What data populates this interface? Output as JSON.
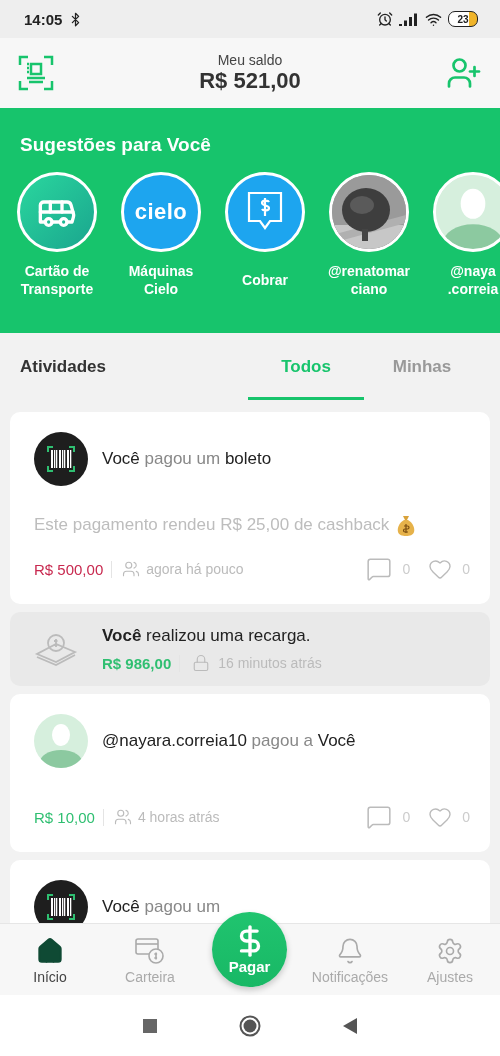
{
  "status_bar": {
    "time": "14:05",
    "battery": "23"
  },
  "header": {
    "balance_label": "Meu saldo",
    "balance": "R$ 521,00"
  },
  "suggestions": {
    "title": "Sugestões para Você",
    "items": [
      {
        "kind": "bus",
        "label_lines": [
          "Cartão de",
          "Transporte"
        ]
      },
      {
        "kind": "cielo",
        "logo_text": "cielo",
        "label_lines": [
          "Máquinas",
          "Cielo"
        ]
      },
      {
        "kind": "charge",
        "label_lines": [
          "Cobrar"
        ]
      },
      {
        "label_lines": [
          "@renatomar",
          "ciano"
        ]
      },
      {
        "kind": "avatar",
        "label_lines": [
          "@naya",
          ".correia"
        ]
      }
    ]
  },
  "activity_tabs": {
    "label": "Atividades",
    "tabs": [
      {
        "label": "Todos",
        "selected": true
      },
      {
        "label": "Minhas",
        "selected": false
      }
    ]
  },
  "feed": [
    {
      "kind": "payment",
      "avatar": {
        "kind": "barcode"
      },
      "title": "**Você** pagou um **boleto**",
      "note": "Este pagamento rendeu R$ 25,00 de cashback",
      "amount": {
        "text": "R$ 500,00",
        "color": "#c8294f"
      },
      "privacy": {
        "kind": "friends"
      },
      "time": "agora há pouco",
      "comments": "0",
      "likes": "0"
    },
    {
      "kind": "recharge",
      "title": "**Você** realizou uma recarga.",
      "amount": {
        "text": "R$ 986,00",
        "color": "#2fbf71"
      },
      "privacy": {
        "kind": "private"
      },
      "time": "16 minutos atrás"
    },
    {
      "kind": "payment",
      "avatar": {
        "kind": "person"
      },
      "title": "**@nayara.correia10** pagou a **Você**",
      "amount": {
        "text": "R$ 10,00",
        "color": "#2fbf71"
      },
      "privacy": {
        "kind": "friends"
      },
      "time": "4 horas atrás",
      "comments": "0",
      "likes": "0"
    },
    {
      "kind": "payment",
      "avatar": {
        "kind": "barcode"
      },
      "title": "**Você** pagou um"
    }
  ],
  "bottom_nav": [
    {
      "kind": "home",
      "label": "Início",
      "selected": true
    },
    {
      "kind": "wallet",
      "label": "Carteira",
      "selected": false
    },
    {
      "kind": "pay",
      "label": "Pagar",
      "selected": false
    },
    {
      "kind": "notifications",
      "label": "Notificações",
      "selected": false
    },
    {
      "kind": "settings",
      "label": "Ajustes",
      "selected": false
    }
  ]
}
